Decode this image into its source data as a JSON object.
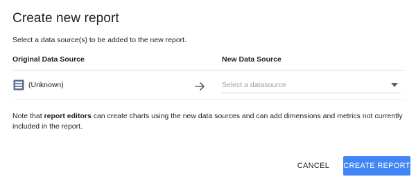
{
  "dialog": {
    "title": "Create new report",
    "subtitle": "Select a data source(s) to be added to the new report."
  },
  "columns": {
    "original": "Original Data Source",
    "new": "New Data Source"
  },
  "row": {
    "source_icon": "table-icon",
    "source_label": "(Unknown)",
    "arrow_icon": "arrow-right-icon",
    "select_placeholder": "Select a datasource",
    "caret_icon": "dropdown-caret-icon"
  },
  "note": {
    "prefix": "Note that ",
    "bold": "report editors",
    "suffix": " can create charts using the new data sources and can add dimensions and metrics not currently included in the report."
  },
  "buttons": {
    "cancel": "CANCEL",
    "create": "CREATE REPORT"
  },
  "colors": {
    "accent": "#4285f4",
    "icon": "#5a6f8e",
    "placeholder": "#9e9e9e"
  }
}
